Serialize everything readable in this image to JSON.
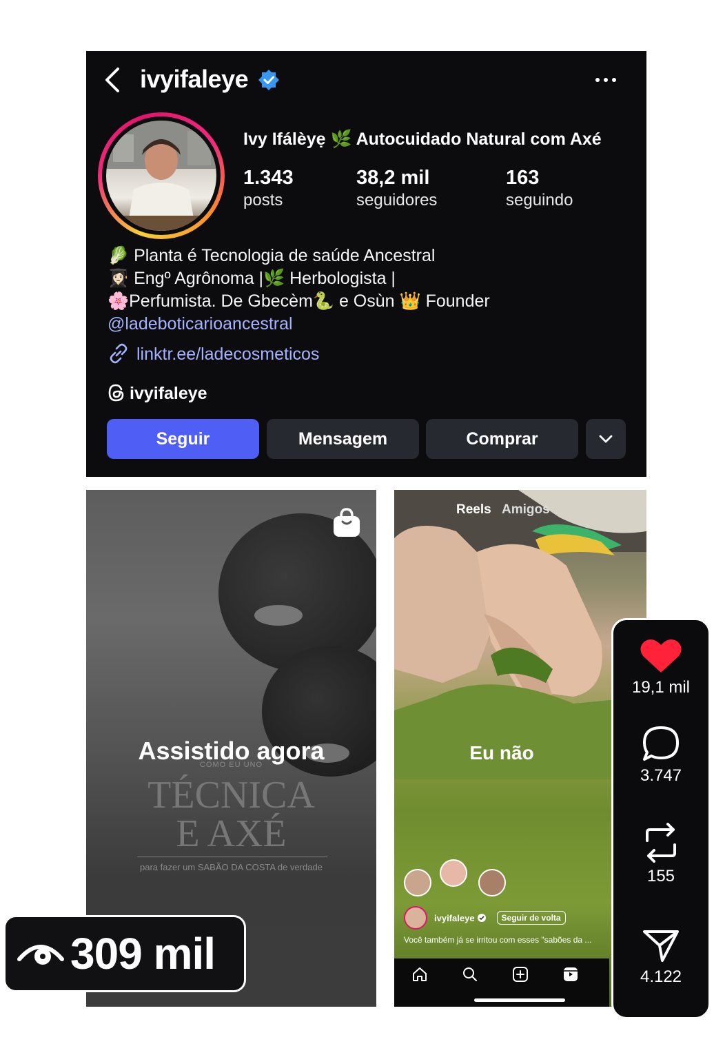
{
  "profile": {
    "username": "ivyifaleye",
    "display_name": "Ivy Ifálèyẹ 🌿 Autocuidado Natural com Axé",
    "stats": [
      {
        "value": "1.343",
        "label": "posts"
      },
      {
        "value": "38,2 mil",
        "label": "seguidores"
      },
      {
        "value": "163",
        "label": "seguindo"
      }
    ],
    "bio_lines": [
      "🥬 Planta é Tecnologia de saúde Ancestral",
      "👩🏻‍🎓 Engº Agrônoma |🌿 Herbologista |",
      "🌸Perfumista. De Gbecèm🐍 e Osùn 👑 Founder"
    ],
    "mention": "@ladeboticarioancestral",
    "link": "linktr.ee/ladecosmeticos",
    "threads_handle": "ivyifaleye",
    "buttons": {
      "follow": "Seguir",
      "message": "Mensagem",
      "shop": "Comprar"
    }
  },
  "tile_left": {
    "title": "Assistido agora",
    "overline": "COMO EU UNO",
    "big_line1": "TÉCNICA",
    "big_line2": "E AXÉ",
    "caption": "para fazer um SABÃO DA COSTA de verdade"
  },
  "views": {
    "count": "309 mil"
  },
  "tile_right": {
    "tabs": {
      "reels": "Reels",
      "friends": "Amigos"
    },
    "big_caption": "Eu não",
    "username": "ivyifaleye",
    "follow_back": "Seguir de volta",
    "description": "Você também já se irritou com esses \"sabões da ..."
  },
  "actions": {
    "likes": "19,1 mil",
    "comments": "3.747",
    "reposts": "155",
    "shares": "4.122"
  },
  "colors": {
    "follow_button": "#4f5ef5",
    "verified": "#3897f0",
    "link": "#a4b3ff",
    "like": "#ff2238"
  }
}
